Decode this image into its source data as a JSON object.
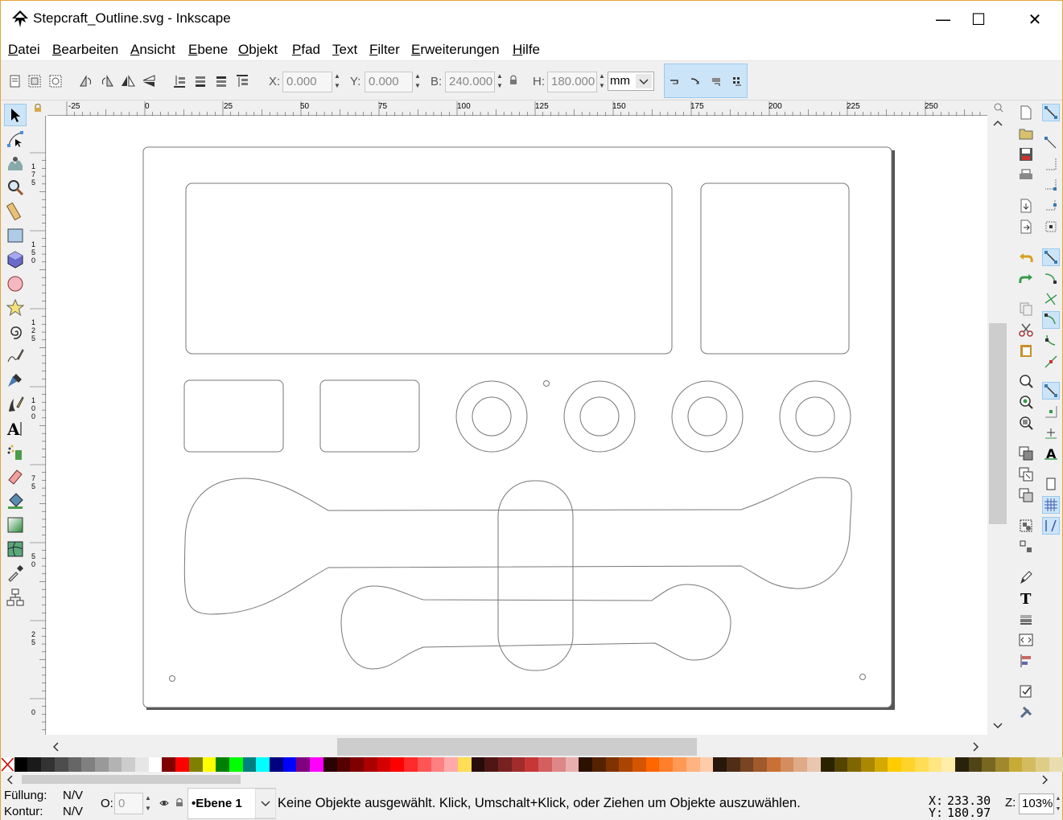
{
  "window": {
    "title": "Stepcraft_Outline.svg - Inkscape",
    "minimize_glyph": "—",
    "maximize_glyph": "☐",
    "close_glyph": "✕"
  },
  "menu": [
    "Datei",
    "Bearbeiten",
    "Ansicht",
    "Ebene",
    "Objekt",
    "Pfad",
    "Text",
    "Filter",
    "Erweiterungen",
    "Hilfe"
  ],
  "toolbar": {
    "x_label": "X:",
    "x_value": "0.000",
    "y_label": "Y:",
    "y_value": "0.000",
    "w_label": "B:",
    "w_value": "240.000",
    "h_label": "H:",
    "h_value": "180.000",
    "unit": "mm",
    "lock_icon": "lock-icon"
  },
  "ruler": {
    "h_ticks": [
      "-25",
      "0",
      "25",
      "50",
      "75",
      "100",
      "125",
      "150",
      "175",
      "200",
      "225",
      "250"
    ],
    "v_ticks": [
      "175",
      "150",
      "125",
      "100",
      "75",
      "50",
      "25",
      "0"
    ]
  },
  "status": {
    "fill_label": "Füllung:",
    "fill_value": "N/V",
    "stroke_label": "Kontur:",
    "stroke_value": "N/V",
    "opacity_label": "O:",
    "opacity_value": "0",
    "layer": "•Ebene 1",
    "message": "Keine Objekte ausgewählt. Klick, Umschalt+Klick, oder Ziehen um Objekte auszuwählen.",
    "x_label": "X:",
    "x_value": "233.30",
    "y_label": "Y:",
    "y_value": "180.97",
    "zoom_label": "Z:",
    "zoom_value": "103%"
  },
  "colors": {
    "accent": "#cce4f7",
    "window_border": "#e8a33d"
  }
}
